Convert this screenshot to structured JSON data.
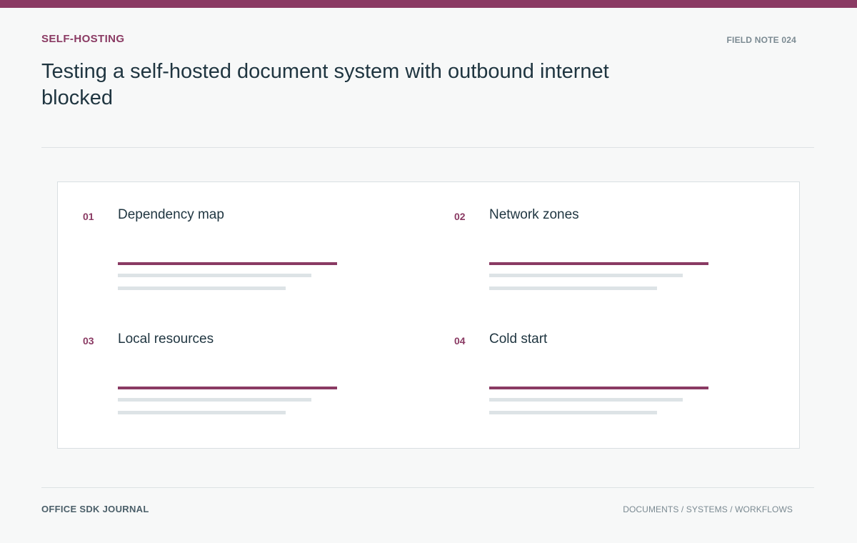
{
  "header": {
    "category": "SELF-HOSTING",
    "field_note": "FIELD NOTE 024",
    "title": "Testing a self-hosted document system with outbound internet blocked"
  },
  "colors": {
    "accent": "#8a3a63",
    "text": "#1f3540",
    "muted": "#7b8a92",
    "placeholder_line": "#dde3e6",
    "background": "#f7f8f8"
  },
  "items": [
    {
      "number": "01",
      "title": "Dependency map"
    },
    {
      "number": "02",
      "title": "Network zones"
    },
    {
      "number": "03",
      "title": "Local resources"
    },
    {
      "number": "04",
      "title": "Cold start"
    }
  ],
  "footer": {
    "brand": "OFFICE SDK JOURNAL",
    "tags": "DOCUMENTS / SYSTEMS / WORKFLOWS"
  }
}
